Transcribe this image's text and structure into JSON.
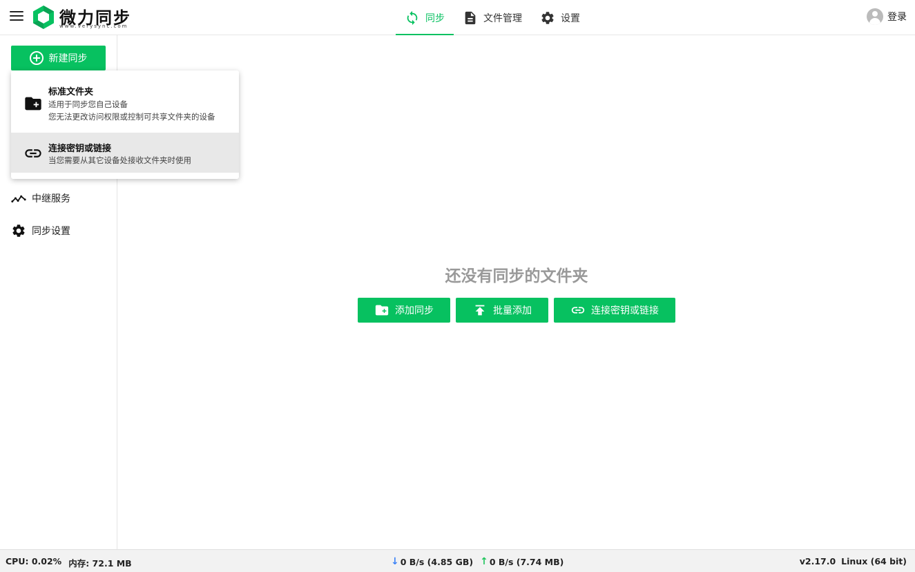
{
  "brand": {
    "name": "微力同步",
    "subtitle": "www.verysync.com",
    "logo_color": "#07c160"
  },
  "nav": {
    "sync": "同步",
    "files": "文件管理",
    "settings": "设置",
    "active": "sync"
  },
  "login": "登录",
  "sidebar": {
    "new_sync": "新建同步",
    "relay": "中继服务",
    "sync_settings": "同步设置"
  },
  "dropdown": {
    "standard": {
      "title": "标准文件夹",
      "desc1": "适用于同步您自己设备",
      "desc2": "您无法更改访问权限或控制可共享文件夹的设备"
    },
    "link": {
      "title": "连接密钥或链接",
      "desc1": "当您需要从其它设备处接收文件夹时使用"
    }
  },
  "main": {
    "empty_title": "还没有同步的文件夹",
    "buttons": {
      "add": "添加同步",
      "batch": "批量添加",
      "link": "连接密钥或链接"
    }
  },
  "status": {
    "cpu": "CPU: 0.02%",
    "mem": "内存: 72.1 MB",
    "download": "0 B/s (4.85 GB)",
    "upload": "0 B/s (7.74 MB)",
    "version": "v2.17.0",
    "os": "Linux (64 bit)"
  },
  "colors": {
    "accent": "#07c160",
    "download_arrow": "#3b82f6",
    "upload_arrow": "#22c55e"
  }
}
